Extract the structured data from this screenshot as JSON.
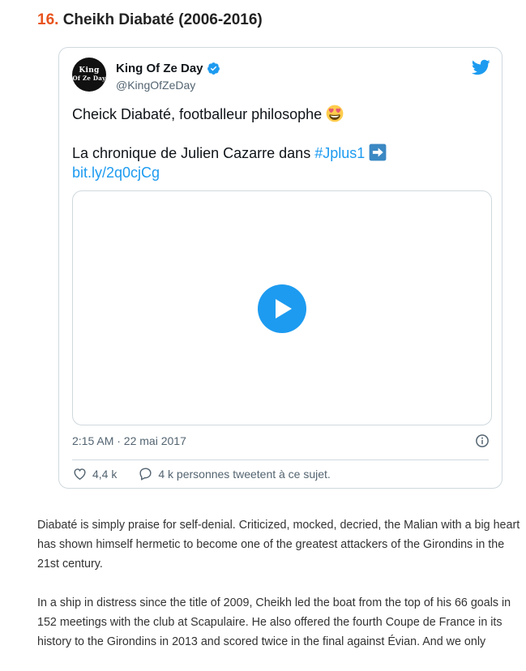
{
  "heading": {
    "number": "16.",
    "title": "Cheikh Diabaté (2006-2016)"
  },
  "tweet": {
    "avatar_text": [
      "King",
      "Of Ze Day"
    ],
    "author_name": "King Of Ze Day",
    "handle": "@KingOfZeDay",
    "line1": "Cheick Diabaté, footballeur philosophe",
    "line2_text": "La chronique de Julien Cazarre dans ",
    "hashtag": "#Jplus1",
    "link": "bit.ly/2q0cjCg",
    "timestamp": "2:15 AM · 22 mai 2017",
    "likes": "4,4 k",
    "replies_text": "4 k personnes tweetent à ce sujet.",
    "accent": "#1d9bf0"
  },
  "article": {
    "paragraphs": [
      "Diabaté is simply praise for self-denial. Criticized, mocked, decried, the Malian with a big heart has shown himself hermetic to become one of the greatest attackers of the Girondins in the 21st century.",
      "In a ship in distress since the title of 2009, Cheikh led the boat from the top of his 66 goals in 152 meetings with the club at Scapulaire. He also offered the fourth Coupe de France in its history to the Girondins in 2013 and scored twice in the final against Évian. And we only"
    ]
  }
}
